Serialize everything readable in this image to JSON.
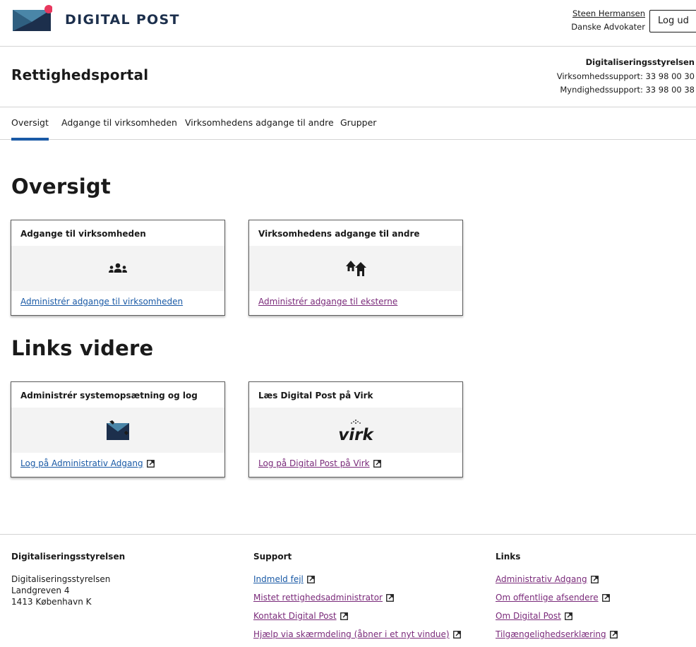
{
  "header": {
    "logo_text": "DIGITAL POST",
    "user_name": "Steen Hermansen",
    "organization": "Danske Advokater",
    "logout_label": "Log ud"
  },
  "portal": {
    "title": "Rettighedsportal",
    "support_org": "Digitaliseringsstyrelsen",
    "business_support": "Virksomhedssupport: 33 98 00 30",
    "authority_support": "Myndighedssupport: 33 98 00 38"
  },
  "tabs": [
    {
      "label": "Oversigt",
      "active": true
    },
    {
      "label": "Adgange til virksomheden",
      "active": false
    },
    {
      "label": "Virksomhedens adgange til andre",
      "active": false
    },
    {
      "label": "Grupper",
      "active": false
    }
  ],
  "overview": {
    "heading": "Oversigt",
    "cards": [
      {
        "title": "Adgange til virksomheden",
        "icon": "people-icon",
        "link": "Administrér adgange til virksomheden"
      },
      {
        "title": "Virksomhedens adgange til andre",
        "icon": "houses-icon",
        "link": "Administrér adgange til eksterne"
      }
    ]
  },
  "links": {
    "heading": "Links videre",
    "cards": [
      {
        "title": "Administrér systemopsætning og log",
        "icon": "admin-tools-icon",
        "link": "Log på Administrativ Adgang"
      },
      {
        "title": "Læs Digital Post på Virk",
        "icon": "virk-logo",
        "logo_text": "virk",
        "link": "Log på Digital Post på Virk"
      }
    ]
  },
  "footer": {
    "col1": {
      "heading": "Digitaliseringsstyrelsen",
      "address": [
        "Digitaliseringsstyrelsen",
        "Landgreven 4",
        "1413 København K"
      ]
    },
    "col2": {
      "heading": "Support",
      "links": [
        "Indmeld fejl",
        "Mistet rettighedsadministrator",
        "Kontakt Digital Post",
        "Hjælp via skærmdeling (åbner i et nyt vindue)"
      ]
    },
    "col3": {
      "heading": "Links",
      "links": [
        "Administrativ Adgang",
        "Om offentlige afsendere",
        "Om Digital Post",
        "Tilgængelighedserklæring"
      ]
    }
  },
  "colors": {
    "brand_navy": "#1c2f4c",
    "brand_pink": "#e8385e",
    "link_blue": "#1a5aa6",
    "link_visited": "#7a2a7a"
  }
}
